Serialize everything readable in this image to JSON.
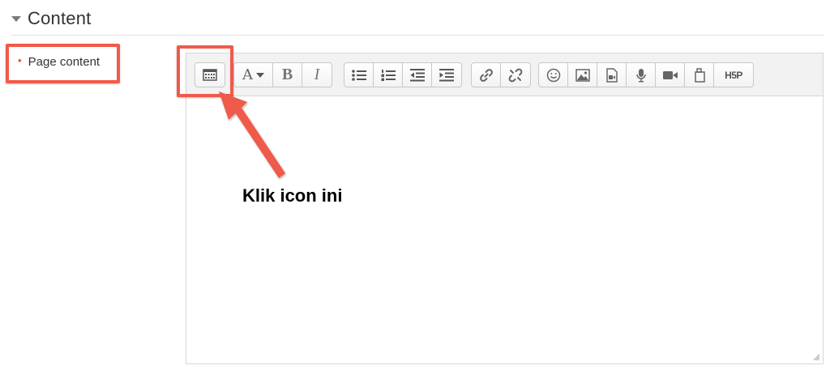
{
  "section": {
    "title": "Content"
  },
  "field": {
    "label": "Page content",
    "required_marker": "*"
  },
  "annotation": {
    "text": "Klik icon ini",
    "color": "#f05a4b"
  },
  "toolbar": {
    "groups": [
      [
        "show-more-buttons-icon"
      ],
      [
        "font-color-icon",
        "bold-icon",
        "italic-icon"
      ],
      [
        "unordered-list-icon",
        "ordered-list-icon",
        "outdent-icon",
        "indent-icon"
      ],
      [
        "link-icon",
        "unlink-icon"
      ],
      [
        "emoticon-icon",
        "image-icon",
        "media-icon",
        "record-audio-icon",
        "record-video-icon",
        "manage-files-icon",
        "h5p-icon"
      ]
    ],
    "bold_glyph": "B",
    "italic_glyph": "I",
    "font_glyph": "A",
    "h5p_label": "H5P"
  }
}
